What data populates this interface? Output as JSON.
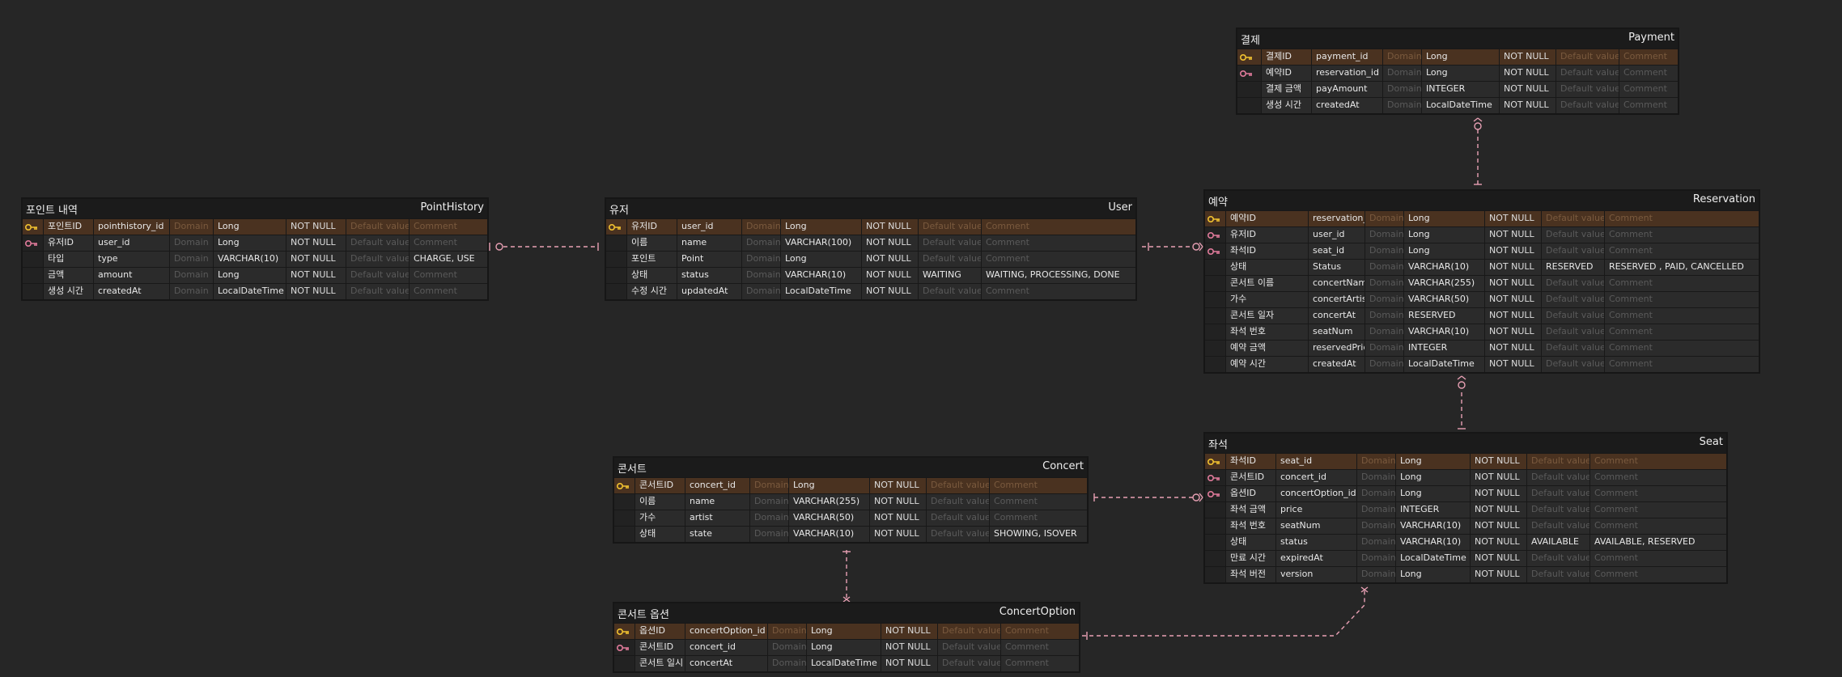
{
  "placeholders": {
    "domain": "Domain",
    "default": "Default value",
    "comment": "Comment"
  },
  "colors": {
    "background": "#262626",
    "pk_row": "#4a3220",
    "relation_line": "#e8a0b4",
    "pk_icon": "#f2c230",
    "fk_icon": "#e07a9a"
  },
  "entities": [
    {
      "id": "payment",
      "logical": "결제",
      "physical": "Payment",
      "rows": [
        {
          "key": "pk",
          "logical": "결제ID",
          "physical": "payment_id",
          "type": "Long",
          "nullable": "NOT NULL",
          "default": "",
          "comment": ""
        },
        {
          "key": "fk",
          "logical": "예약ID",
          "physical": "reservation_id",
          "type": "Long",
          "nullable": "NOT NULL",
          "default": "",
          "comment": ""
        },
        {
          "key": "",
          "logical": "결제 금액",
          "physical": "payAmount",
          "type": "INTEGER",
          "nullable": "NOT NULL",
          "default": "",
          "comment": ""
        },
        {
          "key": "",
          "logical": "생성 시간",
          "physical": "createdAt",
          "type": "LocalDateTime",
          "nullable": "NOT NULL",
          "default": "",
          "comment": ""
        }
      ]
    },
    {
      "id": "pointhistory",
      "logical": "포인트 내역",
      "physical": "PointHistory",
      "rows": [
        {
          "key": "pk",
          "logical": "포인트ID",
          "physical": "pointhistory_id",
          "type": "Long",
          "nullable": "NOT NULL",
          "default": "",
          "comment": ""
        },
        {
          "key": "fk",
          "logical": "유저ID",
          "physical": "user_id",
          "type": "Long",
          "nullable": "NOT NULL",
          "default": "",
          "comment": ""
        },
        {
          "key": "",
          "logical": "타입",
          "physical": "type",
          "type": "VARCHAR(10)",
          "nullable": "NOT NULL",
          "default": "",
          "comment": "CHARGE, USE"
        },
        {
          "key": "",
          "logical": "금액",
          "physical": "amount",
          "type": "Long",
          "nullable": "NOT NULL",
          "default": "",
          "comment": ""
        },
        {
          "key": "",
          "logical": "생성 시간",
          "physical": "createdAt",
          "type": "LocalDateTime",
          "nullable": "NOT NULL",
          "default": "",
          "comment": ""
        }
      ]
    },
    {
      "id": "user",
      "logical": "유저",
      "physical": "User",
      "rows": [
        {
          "key": "pk",
          "logical": "유저ID",
          "physical": "user_id",
          "type": "Long",
          "nullable": "NOT NULL",
          "default": "",
          "comment": ""
        },
        {
          "key": "",
          "logical": "이름",
          "physical": "name",
          "type": "VARCHAR(100)",
          "nullable": "NOT NULL",
          "default": "",
          "comment": ""
        },
        {
          "key": "",
          "logical": "포인트",
          "physical": "Point",
          "type": "Long",
          "nullable": "NOT NULL",
          "default": "",
          "comment": ""
        },
        {
          "key": "",
          "logical": "상태",
          "physical": "status",
          "type": "VARCHAR(10)",
          "nullable": "NOT NULL",
          "default": "WAITING",
          "comment": "WAITING, PROCESSING, DONE"
        },
        {
          "key": "",
          "logical": "수정 시간",
          "physical": "updatedAt",
          "type": "LocalDateTime",
          "nullable": "NOT NULL",
          "default": "",
          "comment": ""
        }
      ]
    },
    {
      "id": "reservation",
      "logical": "예약",
      "physical": "Reservation",
      "rows": [
        {
          "key": "pk",
          "logical": "예약ID",
          "physical": "reservation_id",
          "type": "Long",
          "nullable": "NOT NULL",
          "default": "",
          "comment": ""
        },
        {
          "key": "fk",
          "logical": "유저ID",
          "physical": "user_id",
          "type": "Long",
          "nullable": "NOT NULL",
          "default": "",
          "comment": ""
        },
        {
          "key": "fk",
          "logical": "좌석ID",
          "physical": "seat_id",
          "type": "Long",
          "nullable": "NOT NULL",
          "default": "",
          "comment": ""
        },
        {
          "key": "",
          "logical": "상태",
          "physical": "Status",
          "type": "VARCHAR(10)",
          "nullable": "NOT NULL",
          "default": "RESERVED",
          "comment": "RESERVED ,  PAID, CANCELLED"
        },
        {
          "key": "",
          "logical": "콘서트 이름",
          "physical": "concertName",
          "type": "VARCHAR(255)",
          "nullable": "NOT NULL",
          "default": "",
          "comment": ""
        },
        {
          "key": "",
          "logical": "가수",
          "physical": "concertArtist",
          "type": "VARCHAR(50)",
          "nullable": "NOT NULL",
          "default": "",
          "comment": ""
        },
        {
          "key": "",
          "logical": "콘서트 일자",
          "physical": "concertAt",
          "type": "RESERVED",
          "nullable": "NOT NULL",
          "default": "",
          "comment": ""
        },
        {
          "key": "",
          "logical": "좌석 번호",
          "physical": "seatNum",
          "type": "VARCHAR(10)",
          "nullable": "NOT NULL",
          "default": "",
          "comment": ""
        },
        {
          "key": "",
          "logical": "예약 금액",
          "physical": "reservedPrice",
          "type": "INTEGER",
          "nullable": "NOT NULL",
          "default": "",
          "comment": ""
        },
        {
          "key": "",
          "logical": "예약 시간",
          "physical": "createdAt",
          "type": "LocalDateTime",
          "nullable": "NOT NULL",
          "default": "",
          "comment": ""
        }
      ]
    },
    {
      "id": "concert",
      "logical": "콘서트",
      "physical": "Concert",
      "rows": [
        {
          "key": "pk",
          "logical": "콘서트ID",
          "physical": "concert_id",
          "type": "Long",
          "nullable": "NOT NULL",
          "default": "",
          "comment": ""
        },
        {
          "key": "",
          "logical": "이름",
          "physical": "name",
          "type": "VARCHAR(255)",
          "nullable": "NOT NULL",
          "default": "",
          "comment": ""
        },
        {
          "key": "",
          "logical": "가수",
          "physical": "artist",
          "type": "VARCHAR(50)",
          "nullable": "NOT NULL",
          "default": "",
          "comment": ""
        },
        {
          "key": "",
          "logical": "상태",
          "physical": "state",
          "type": "VARCHAR(10)",
          "nullable": "NOT NULL",
          "default": "",
          "comment": "SHOWING, ISOVER"
        }
      ]
    },
    {
      "id": "seat",
      "logical": "좌석",
      "physical": "Seat",
      "rows": [
        {
          "key": "pk",
          "logical": "좌석ID",
          "physical": "seat_id",
          "type": "Long",
          "nullable": "NOT NULL",
          "default": "",
          "comment": ""
        },
        {
          "key": "fk",
          "logical": "콘서트ID",
          "physical": "concert_id",
          "type": "Long",
          "nullable": "NOT NULL",
          "default": "",
          "comment": ""
        },
        {
          "key": "fk",
          "logical": "옵션ID",
          "physical": "concertOption_id",
          "type": "Long",
          "nullable": "NOT NULL",
          "default": "",
          "comment": ""
        },
        {
          "key": "",
          "logical": "좌석 금액",
          "physical": "price",
          "type": "INTEGER",
          "nullable": "NOT NULL",
          "default": "",
          "comment": ""
        },
        {
          "key": "",
          "logical": "좌석 번호",
          "physical": "seatNum",
          "type": "VARCHAR(10)",
          "nullable": "NOT NULL",
          "default": "",
          "comment": ""
        },
        {
          "key": "",
          "logical": "상태",
          "physical": "status",
          "type": "VARCHAR(10)",
          "nullable": "NOT NULL",
          "default": "AVAILABLE",
          "comment": "AVAILABLE, RESERVED"
        },
        {
          "key": "",
          "logical": "만료 시간",
          "physical": "expiredAt",
          "type": "LocalDateTime",
          "nullable": "NOT NULL",
          "default": "",
          "comment": ""
        },
        {
          "key": "",
          "logical": "좌석 버전",
          "physical": "version",
          "type": "Long",
          "nullable": "NOT NULL",
          "default": "",
          "comment": ""
        }
      ]
    },
    {
      "id": "concertoption",
      "logical": "콘서트 옵션",
      "physical": "ConcertOption",
      "rows": [
        {
          "key": "pk",
          "logical": "옵션ID",
          "physical": "concertOption_id",
          "type": "Long",
          "nullable": "NOT NULL",
          "default": "",
          "comment": ""
        },
        {
          "key": "fk",
          "logical": "콘서트ID",
          "physical": "concert_id",
          "type": "Long",
          "nullable": "NOT NULL",
          "default": "",
          "comment": ""
        },
        {
          "key": "",
          "logical": "콘서트 일시",
          "physical": "concertAt",
          "type": "LocalDateTime",
          "nullable": "NOT NULL",
          "default": "",
          "comment": ""
        }
      ]
    }
  ]
}
